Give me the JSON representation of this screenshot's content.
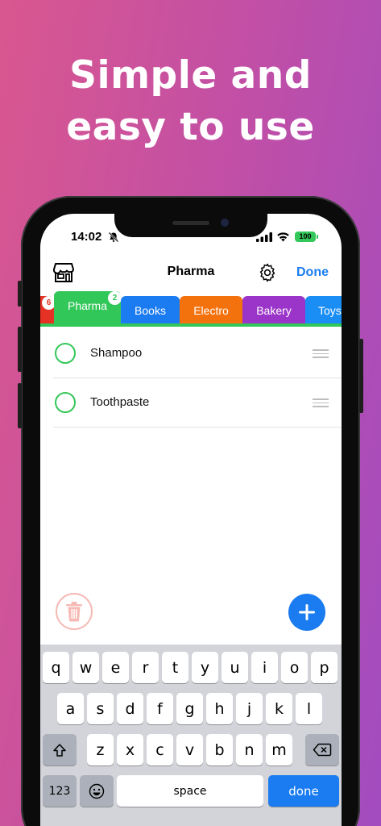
{
  "headline": {
    "line1": "Simple and",
    "line2": "easy to use"
  },
  "status_bar": {
    "time": "14:02",
    "battery": "100"
  },
  "nav": {
    "title": "Pharma",
    "done_label": "Done",
    "icons": [
      "store-icon",
      "gear-icon"
    ]
  },
  "tabs": [
    {
      "label": "",
      "color": "#e53225",
      "badge": "6",
      "badge_color": "#e53225"
    },
    {
      "label": "Pharma",
      "color": "#32c759",
      "badge": "2",
      "badge_color": "#32c759",
      "active": true
    },
    {
      "label": "Books",
      "color": "#1a7cf0"
    },
    {
      "label": "Electro",
      "color": "#f4720e"
    },
    {
      "label": "Bakery",
      "color": "#9b34c8"
    },
    {
      "label": "Toys",
      "color": "#1a8ef5"
    }
  ],
  "items": [
    {
      "label": "Shampoo"
    },
    {
      "label": "Toothpaste"
    }
  ],
  "colors": {
    "accent": "#1a7cf0",
    "check": "#34c759",
    "trash": "#f6b9b4"
  },
  "keyboard": {
    "row1": [
      "q",
      "w",
      "e",
      "r",
      "t",
      "y",
      "u",
      "i",
      "o",
      "p"
    ],
    "row2": [
      "a",
      "s",
      "d",
      "f",
      "g",
      "h",
      "j",
      "k",
      "l"
    ],
    "row3": [
      "z",
      "x",
      "c",
      "v",
      "b",
      "n",
      "m"
    ],
    "numbers_label": "123",
    "space_label": "space",
    "done_label": "done"
  }
}
